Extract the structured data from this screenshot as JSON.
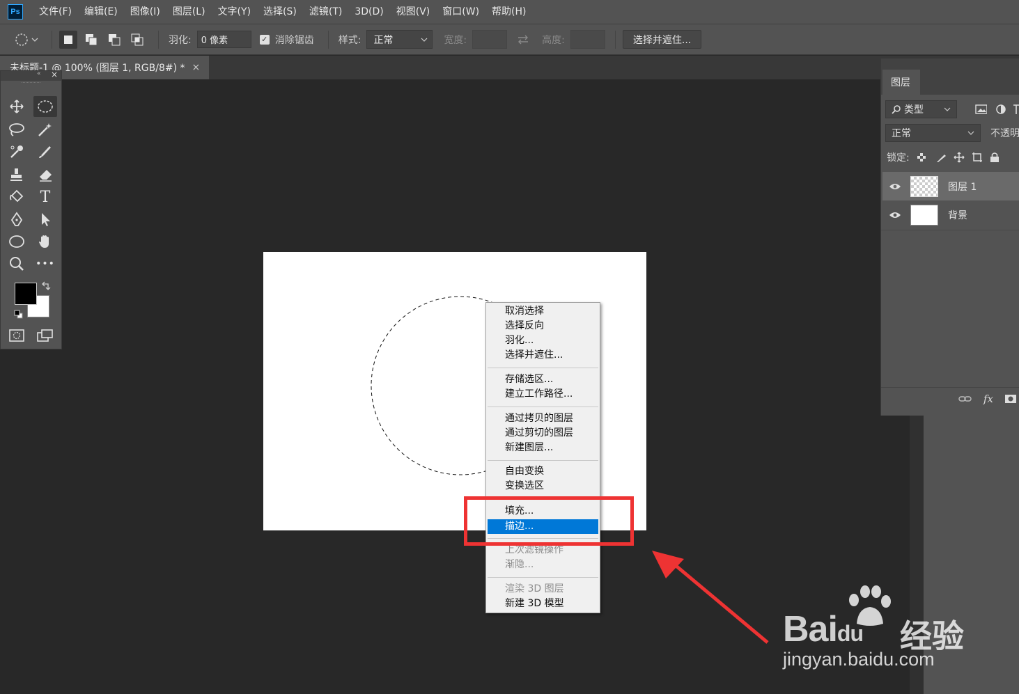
{
  "app": {
    "logo": "Ps"
  },
  "menubar": [
    "文件(F)",
    "编辑(E)",
    "图像(I)",
    "图层(L)",
    "文字(Y)",
    "选择(S)",
    "滤镜(T)",
    "3D(D)",
    "视图(V)",
    "窗口(W)",
    "帮助(H)"
  ],
  "options": {
    "feather_label": "羽化:",
    "feather_value": "0 像素",
    "antialias_label": "消除锯齿",
    "antialias_checked": true,
    "style_label": "样式:",
    "style_value": "正常",
    "width_label": "宽度:",
    "height_label": "高度:",
    "select_mask_button": "选择并遮住..."
  },
  "document": {
    "tab_title": "未标题-1 @ 100% (图层 1, RGB/8#) *",
    "close": "×"
  },
  "toolbar": {
    "collapse": "«",
    "close": "×",
    "more_tools": "•••",
    "type_tool": "T"
  },
  "context_menu": {
    "items": [
      {
        "label": "取消选择",
        "enabled": true
      },
      {
        "label": "选择反向",
        "enabled": true
      },
      {
        "label": "羽化...",
        "enabled": true
      },
      {
        "label": "选择并遮住...",
        "enabled": true
      },
      {
        "label": "存储选区...",
        "enabled": true
      },
      {
        "label": "建立工作路径...",
        "enabled": true
      },
      {
        "label": "通过拷贝的图层",
        "enabled": true
      },
      {
        "label": "通过剪切的图层",
        "enabled": true
      },
      {
        "label": "新建图层...",
        "enabled": true
      },
      {
        "label": "自由变换",
        "enabled": true
      },
      {
        "label": "变换选区",
        "enabled": true
      },
      {
        "label": "填充...",
        "enabled": true
      },
      {
        "label": "描边...",
        "enabled": true,
        "highlighted": true
      },
      {
        "label": "上次滤镜操作",
        "enabled": false
      },
      {
        "label": "渐隐...",
        "enabled": false
      },
      {
        "label": "渲染 3D 图层",
        "enabled": false
      },
      {
        "label": "新建 3D 模型",
        "enabled": true
      }
    ],
    "highlight_color": "#0078d7"
  },
  "annotation": {
    "box_color": "#ee3333"
  },
  "layers_panel": {
    "tab": "图层",
    "filter_kind": "类型",
    "blend_mode": "正常",
    "opacity_label": "不透明",
    "lock_label": "锁定:",
    "layers": [
      {
        "name": "图层 1",
        "selected": true,
        "thumb": "transparent"
      },
      {
        "name": "背景",
        "selected": false,
        "thumb": "white"
      }
    ],
    "bottom_fx": "fx"
  },
  "watermark": {
    "brand_a": "Bai",
    "brand_b": "du",
    "brand_cn": "经验",
    "url": "jingyan.baidu.com"
  }
}
